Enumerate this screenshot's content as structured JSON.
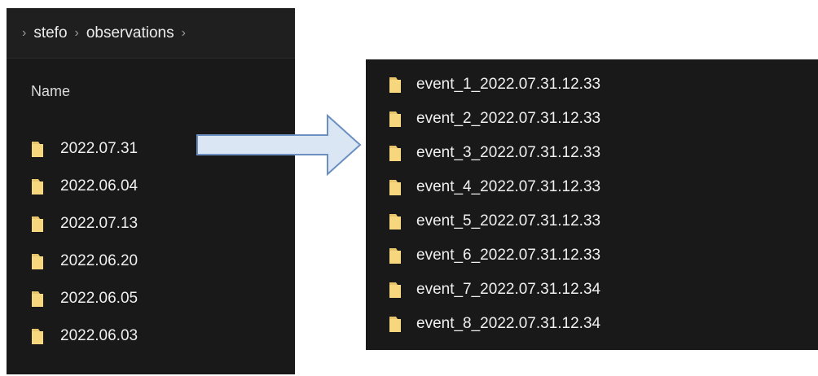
{
  "left_window": {
    "breadcrumb": [
      {
        "label": "stefo"
      },
      {
        "label": "observations"
      }
    ],
    "column_header": "Name",
    "folders": [
      {
        "label": "2022.07.31"
      },
      {
        "label": "2022.06.04"
      },
      {
        "label": "2022.07.13"
      },
      {
        "label": "2022.06.20"
      },
      {
        "label": "2022.06.05"
      },
      {
        "label": "2022.06.03"
      }
    ]
  },
  "right_window": {
    "folders": [
      {
        "label": "event_1_2022.07.31.12.33"
      },
      {
        "label": "event_2_2022.07.31.12.33"
      },
      {
        "label": "event_3_2022.07.31.12.33"
      },
      {
        "label": "event_4_2022.07.31.12.33"
      },
      {
        "label": "event_5_2022.07.31.12.33"
      },
      {
        "label": "event_6_2022.07.31.12.33"
      },
      {
        "label": "event_7_2022.07.31.12.34"
      },
      {
        "label": "event_8_2022.07.31.12.34"
      }
    ]
  },
  "icons": {
    "folder": "folder-icon",
    "chevron": "chevron-right-icon",
    "arrow": "arrow-right-icon"
  },
  "colors": {
    "window_bg": "#191919",
    "folder": "#e8c56a",
    "arrow_fill": "#dbe6f4",
    "arrow_stroke": "#6a8fc0"
  }
}
